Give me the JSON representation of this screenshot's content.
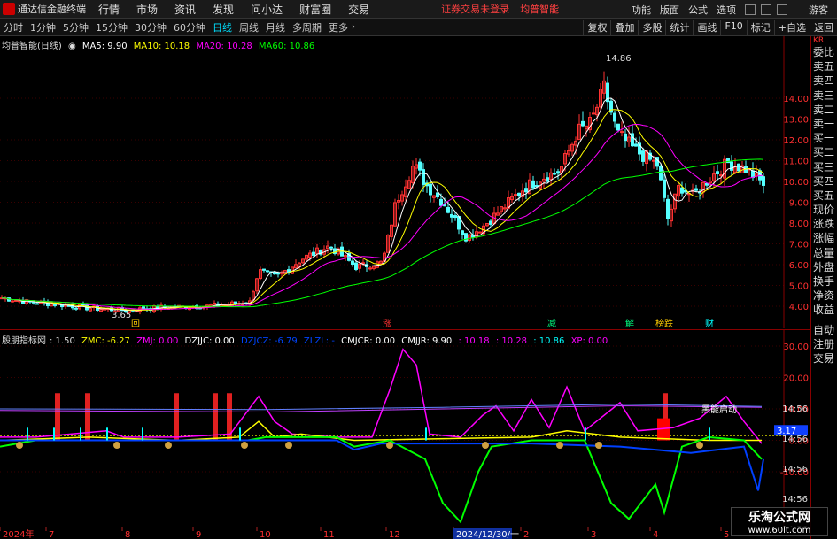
{
  "menubar": {
    "app_title": "通达信金融终端",
    "menus": [
      "行情",
      "市场",
      "资讯",
      "发现",
      "问小达",
      "财富圈",
      "交易"
    ],
    "alert_login": "证券交易未登录",
    "alert_stock": "均普智能",
    "right_items": [
      "功能",
      "版面",
      "公式",
      "选项"
    ],
    "guest": "游客"
  },
  "toolbar": {
    "periods": [
      "分时",
      "1分钟",
      "5分钟",
      "15分钟",
      "30分钟",
      "60分钟",
      "日线",
      "周线",
      "月线",
      "多周期",
      "更多"
    ],
    "active_period": "日线",
    "right_buttons": [
      "复权",
      "叠加",
      "多股",
      "统计",
      "画线",
      "F10",
      "标记",
      "+自选",
      "返回"
    ]
  },
  "main_legend": {
    "stock": "均普智能(日线)",
    "ma5": "MA5: 9.90",
    "ma10": "MA10: 10.18",
    "ma20": "MA20: 10.28",
    "ma60": "MA60: 10.86"
  },
  "price_axis": [
    "14.00",
    "13.00",
    "12.00",
    "11.00",
    "10.00",
    "9.00",
    "8.00",
    "7.00",
    "6.00",
    "5.00",
    "4.00"
  ],
  "price_high_label": "14.86",
  "price_low_label": "3.65",
  "event_tags": [
    "回",
    "涨",
    "减",
    "解",
    "榜跌",
    "财"
  ],
  "ind_legend": {
    "name": "殷朋指标网",
    "v1": ": 1.50",
    "zmc": "ZMC: -6.27",
    "zmj": "ZMJ: 0.00",
    "dzjjc": "DZJJC: 0.00",
    "dzjcz": "DZJCZ: -6.79",
    "zlzl": "ZLZL: -",
    "cmjcr": "CMJCR: 0.00",
    "cmjjr": "CMJJR: 9.90",
    "ma1": ": 10.18",
    "ma2": ": 10.28",
    "ma3": ": 10.86",
    "xp": "XP: 0.00"
  },
  "ind_axis": [
    "30.00",
    "20.00",
    "10.00",
    "0.00",
    "-10.00"
  ],
  "ind_current_value": "3.17",
  "ind_annotation": "黑能启动",
  "ind_right_labels": [
    "14:56",
    "14:56",
    "14:56",
    "14:56",
    "14:56"
  ],
  "xaxis_labels": [
    "2024年",
    "7",
    "8",
    "9",
    "10",
    "11",
    "12",
    "2024/12/30/一",
    "2",
    "3",
    "4",
    "5"
  ],
  "side_panel": [
    "委比",
    "卖五",
    "卖四",
    "卖三",
    "卖二",
    "卖一",
    "买一",
    "买二",
    "买三",
    "买四",
    "买五",
    "现价",
    "涨跌",
    "涨幅",
    "总量",
    "外盘",
    "换手",
    "净资",
    "收益"
  ],
  "side_panel_2": [
    "自动",
    "注册",
    "交易"
  ],
  "side_header": "KR",
  "watermark": {
    "title": "乐淘公式网",
    "url": "www.60lt.com"
  },
  "colors": {
    "up": "#ff3232",
    "down": "#54ffff",
    "ma5": "#ffffff",
    "ma10": "#ffff00",
    "ma20": "#ff00ff",
    "ma60": "#00ff00",
    "ind_green": "#00ff00",
    "ind_magenta": "#ff00ff",
    "ind_blue": "#0040ff"
  }
}
